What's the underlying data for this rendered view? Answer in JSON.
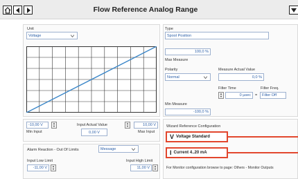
{
  "window": {
    "title": "Flow Reference Analog Range"
  },
  "unit": {
    "label": "Unit",
    "value": "Voltage"
  },
  "type": {
    "label": "Type",
    "value": "Spool Position"
  },
  "max_measure": {
    "value": "100,0 %",
    "label": "Max Measure"
  },
  "polarity": {
    "label": "Polarity",
    "value": "Normal"
  },
  "measure_actual_value": {
    "label": "Measure Actual Value",
    "value": "0,0 %"
  },
  "filter_time": {
    "label": "Filter Time",
    "value": "0 µsec"
  },
  "equals_sign": "=",
  "filter_freq": {
    "label": "Filter Freq.",
    "value": "Filter Off"
  },
  "min_measure": {
    "label": "Min Measure",
    "value": "-100,0 %"
  },
  "min_input": {
    "value": "-10,00 V",
    "label": "Min Input"
  },
  "input_actual_value": {
    "label": "Input Actual Value",
    "value": "0,00 V"
  },
  "max_input": {
    "value": "10,00 V",
    "label": "Max Input"
  },
  "alarm_reaction": {
    "label": "Alarm Reaction - Out Of Limits",
    "value": "Message"
  },
  "input_low_limit": {
    "label": "Input  Low Limit",
    "value": "-11,00 V"
  },
  "input_high_limit": {
    "label": "Input High Limit",
    "value": "11,00 V"
  },
  "wizard": {
    "label": "Wizard Reference Configuration",
    "voltage_button": "Voltage Standard",
    "voltage_icon": "V",
    "current_button": "Current 4..20 mA",
    "current_icon": "I"
  },
  "monitor_note": "For Monitor configuration browse to page: Others - Monitor Outputs",
  "graph": {
    "line_color": "#3a86c8",
    "grid_color": "#333333"
  },
  "icons": [
    "home-icon",
    "back-arrow-icon",
    "forward-arrow-icon",
    "menu-dropdown-icon",
    "chevron-down-icon",
    "spinner-arrows-icon"
  ],
  "colors": {
    "highlight": "#e2462d",
    "field_text": "#2a5ea8"
  }
}
